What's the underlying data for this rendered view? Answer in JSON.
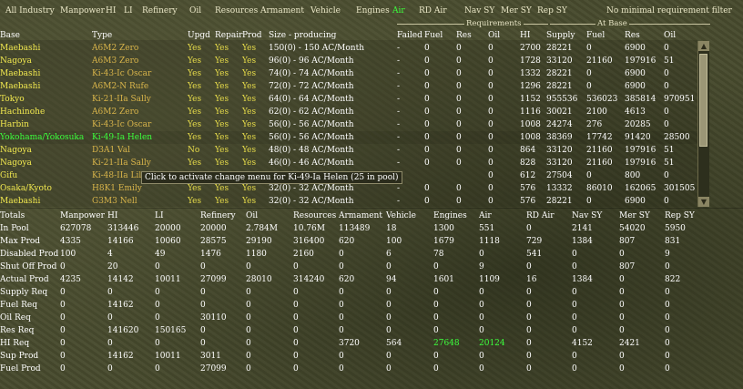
{
  "filters": [
    {
      "label": "All Industry",
      "selected": false
    },
    {
      "label": "Manpower",
      "selected": false
    },
    {
      "label": "HI",
      "selected": false
    },
    {
      "label": "LI",
      "selected": false
    },
    {
      "label": "Refinery",
      "selected": false
    },
    {
      "label": "Oil",
      "selected": false
    },
    {
      "label": "Resources",
      "selected": false
    },
    {
      "label": "Armament",
      "selected": false
    },
    {
      "label": "Vehicle",
      "selected": false
    },
    {
      "label": "Engines",
      "selected": false
    },
    {
      "label": "Air",
      "selected": true
    },
    {
      "label": "RD Air",
      "selected": false
    },
    {
      "label": "Nav SY",
      "selected": false
    },
    {
      "label": "Mer SY",
      "selected": false
    },
    {
      "label": "Rep SY",
      "selected": false
    }
  ],
  "no_minimal_filter": "No minimal requirement filter",
  "groups": {
    "requirements": "Requirements",
    "at_base": "At Base"
  },
  "columns": [
    "Base",
    "Type",
    "Upgd",
    "Repair",
    "Prod",
    "Size - producing",
    "Failed",
    "Fuel",
    "Res",
    "Oil",
    "HI",
    "Supply",
    "Fuel",
    "Res",
    "Oil"
  ],
  "rows": [
    {
      "base": "Maebashi",
      "type": "A6M2 Zero",
      "upgd": "Yes",
      "repair": "Yes",
      "prod": "Yes",
      "size": "150(0) - 150 AC/Month",
      "failed": "-",
      "fuel": "0",
      "res": "0",
      "oil": "0",
      "hi": "2700",
      "supply": "28221",
      "bfuel": "0",
      "bres": "6900",
      "boil": "0"
    },
    {
      "base": "Nagoya",
      "type": "A6M3 Zero",
      "upgd": "Yes",
      "repair": "Yes",
      "prod": "Yes",
      "size": "96(0) - 96 AC/Month",
      "failed": "-",
      "fuel": "0",
      "res": "0",
      "oil": "0",
      "hi": "1728",
      "supply": "33120",
      "bfuel": "21160",
      "bres": "197916",
      "boil": "51"
    },
    {
      "base": "Maebashi",
      "type": "Ki-43-Ic Oscar",
      "upgd": "Yes",
      "repair": "Yes",
      "prod": "Yes",
      "size": "74(0) - 74 AC/Month",
      "failed": "-",
      "fuel": "0",
      "res": "0",
      "oil": "0",
      "hi": "1332",
      "supply": "28221",
      "bfuel": "0",
      "bres": "6900",
      "boil": "0"
    },
    {
      "base": "Maebashi",
      "type": "A6M2-N Rufe",
      "upgd": "Yes",
      "repair": "Yes",
      "prod": "Yes",
      "size": "72(0) - 72 AC/Month",
      "failed": "-",
      "fuel": "0",
      "res": "0",
      "oil": "0",
      "hi": "1296",
      "supply": "28221",
      "bfuel": "0",
      "bres": "6900",
      "boil": "0"
    },
    {
      "base": "Tokyo",
      "type": "Ki-21-IIa Sally",
      "upgd": "Yes",
      "repair": "Yes",
      "prod": "Yes",
      "size": "64(0) - 64 AC/Month",
      "failed": "-",
      "fuel": "0",
      "res": "0",
      "oil": "0",
      "hi": "1152",
      "supply": "955536",
      "bfuel": "536023",
      "bres": "385814",
      "boil": "970951"
    },
    {
      "base": "Hachinohe",
      "type": "A6M2 Zero",
      "upgd": "Yes",
      "repair": "Yes",
      "prod": "Yes",
      "size": "62(0) - 62 AC/Month",
      "failed": "-",
      "fuel": "0",
      "res": "0",
      "oil": "0",
      "hi": "1116",
      "supply": "30021",
      "bfuel": "2100",
      "bres": "4613",
      "boil": "0"
    },
    {
      "base": "Harbin",
      "type": "Ki-43-Ic Oscar",
      "upgd": "Yes",
      "repair": "Yes",
      "prod": "Yes",
      "size": "56(0) - 56 AC/Month",
      "failed": "-",
      "fuel": "0",
      "res": "0",
      "oil": "0",
      "hi": "1008",
      "supply": "24274",
      "bfuel": "276",
      "bres": "20285",
      "boil": "0"
    },
    {
      "base": "Yokohama/Yokosuka",
      "type": "Ki-49-Ia Helen",
      "upgd": "Yes",
      "repair": "Yes",
      "prod": "Yes",
      "size": "56(0) - 56 AC/Month",
      "failed": "-",
      "fuel": "0",
      "res": "0",
      "oil": "0",
      "hi": "1008",
      "supply": "38369",
      "bfuel": "17742",
      "bres": "91420",
      "boil": "28500",
      "highlight": true
    },
    {
      "base": "Nagoya",
      "type": "D3A1 Val",
      "upgd": "No",
      "repair": "Yes",
      "prod": "Yes",
      "size": "48(0) - 48 AC/Month",
      "failed": "-",
      "fuel": "0",
      "res": "0",
      "oil": "0",
      "hi": "864",
      "supply": "33120",
      "bfuel": "21160",
      "bres": "197916",
      "boil": "51"
    },
    {
      "base": "Nagoya",
      "type": "Ki-21-IIa Sally",
      "upgd": "Yes",
      "repair": "Yes",
      "prod": "Yes",
      "size": "46(0) - 46 AC/Month",
      "failed": "-",
      "fuel": "0",
      "res": "0",
      "oil": "0",
      "hi": "828",
      "supply": "33120",
      "bfuel": "21160",
      "bres": "197916",
      "boil": "51"
    },
    {
      "base": "Gifu",
      "type": "Ki-48-IIa Lily",
      "upgd": "",
      "repair": "",
      "prod": "",
      "size": "",
      "failed": "",
      "fuel": "",
      "res": "",
      "oil": "0",
      "hi": "612",
      "supply": "27504",
      "bfuel": "0",
      "bres": "800",
      "boil": "0"
    },
    {
      "base": "Osaka/Kyoto",
      "type": "H8K1 Emily",
      "upgd": "Yes",
      "repair": "Yes",
      "prod": "Yes",
      "size": "32(0) - 32 AC/Month",
      "failed": "-",
      "fuel": "0",
      "res": "0",
      "oil": "0",
      "hi": "576",
      "supply": "13332",
      "bfuel": "86010",
      "bres": "162065",
      "boil": "301505"
    },
    {
      "base": "Maebashi",
      "type": "G3M3 Nell",
      "upgd": "Yes",
      "repair": "Yes",
      "prod": "Yes",
      "size": "32(0) - 32 AC/Month",
      "failed": "-",
      "fuel": "0",
      "res": "0",
      "oil": "0",
      "hi": "576",
      "supply": "28221",
      "bfuel": "0",
      "bres": "6900",
      "boil": "0"
    }
  ],
  "tooltip": "Click to activate change menu for Ki-49-Ia Helen (25 in pool)",
  "totals_header": [
    "Totals",
    "Manpower",
    "HI",
    "LI",
    "Refinery",
    "Oil",
    "Resources",
    "Armament",
    "Vehicle",
    "Engines",
    "Air",
    "RD Air",
    "Nav SY",
    "Mer SY",
    "Rep SY"
  ],
  "totals_rows": [
    {
      "label": "In Pool",
      "values": [
        "627078",
        "313446",
        "20000",
        "20000",
        "2.784M",
        "10.76M",
        "113489",
        "18",
        "1300",
        "551",
        "0",
        "2141",
        "54020",
        "5950"
      ]
    },
    {
      "label": "Max Prod",
      "values": [
        "4335",
        "14166",
        "10060",
        "28575",
        "29190",
        "316400",
        "620",
        "100",
        "1679",
        "1118",
        "729",
        "1384",
        "807",
        "831"
      ]
    },
    {
      "label": "Disabled Prod",
      "values": [
        "100",
        "4",
        "49",
        "1476",
        "1180",
        "2160",
        "0",
        "6",
        "78",
        "0",
        "541",
        "0",
        "0",
        "9"
      ]
    },
    {
      "label": "Shut Off Prod",
      "values": [
        "0",
        "20",
        "0",
        "0",
        "0",
        "0",
        "0",
        "0",
        "0",
        "9",
        "0",
        "0",
        "807",
        "0"
      ]
    },
    {
      "label": "Actual Prod",
      "values": [
        "4235",
        "14142",
        "10011",
        "27099",
        "28010",
        "314240",
        "620",
        "94",
        "1601",
        "1109",
        "16",
        "1384",
        "0",
        "822"
      ]
    },
    {
      "label": "Supply Req",
      "values": [
        "0",
        "0",
        "0",
        "0",
        "0",
        "0",
        "0",
        "0",
        "0",
        "0",
        "0",
        "0",
        "0",
        "0"
      ]
    },
    {
      "label": "Fuel Req",
      "values": [
        "0",
        "14162",
        "0",
        "0",
        "0",
        "0",
        "0",
        "0",
        "0",
        "0",
        "0",
        "0",
        "0",
        "0"
      ]
    },
    {
      "label": "Oil Req",
      "values": [
        "0",
        "0",
        "0",
        "30110",
        "0",
        "0",
        "0",
        "0",
        "0",
        "0",
        "0",
        "0",
        "0",
        "0"
      ]
    },
    {
      "label": "Res Req",
      "values": [
        "0",
        "141620",
        "150165",
        "0",
        "0",
        "0",
        "0",
        "0",
        "0",
        "0",
        "0",
        "0",
        "0",
        "0"
      ]
    },
    {
      "label": "HI Req",
      "values": [
        "0",
        "0",
        "0",
        "0",
        "0",
        "0",
        "3720",
        "564",
        "27648",
        "20124",
        "0",
        "4152",
        "2421",
        "0"
      ],
      "green": [
        8,
        9
      ]
    },
    {
      "label": "Sup Prod",
      "values": [
        "0",
        "14162",
        "10011",
        "3011",
        "0",
        "0",
        "0",
        "0",
        "0",
        "0",
        "0",
        "0",
        "0",
        "0"
      ]
    },
    {
      "label": "Fuel Prod",
      "values": [
        "0",
        "0",
        "0",
        "27099",
        "0",
        "0",
        "0",
        "0",
        "0",
        "0",
        "0",
        "0",
        "0",
        "0"
      ]
    }
  ]
}
